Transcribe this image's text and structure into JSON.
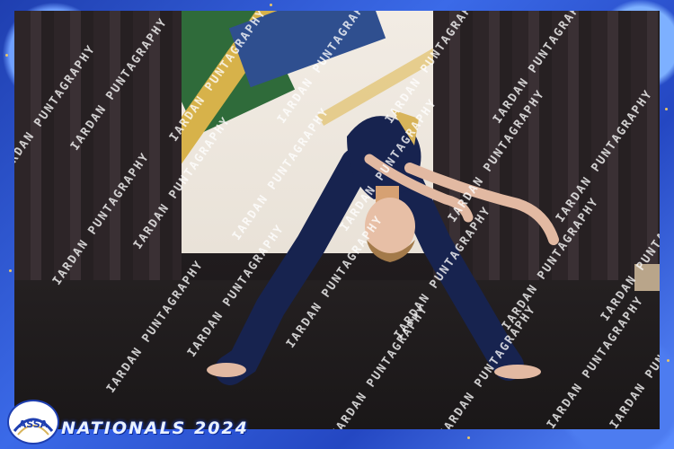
{
  "photo": {
    "subject": "dancer-back-bend",
    "watermark_text": "IARDAN PUNTAGRAPHY"
  },
  "branding": {
    "logo_text": "ASSA",
    "event_title": "NATIONALS 2024"
  },
  "colors": {
    "frame_blue": "#2a52c9",
    "costume_navy": "#17234f",
    "watermark": "#ffffff"
  }
}
